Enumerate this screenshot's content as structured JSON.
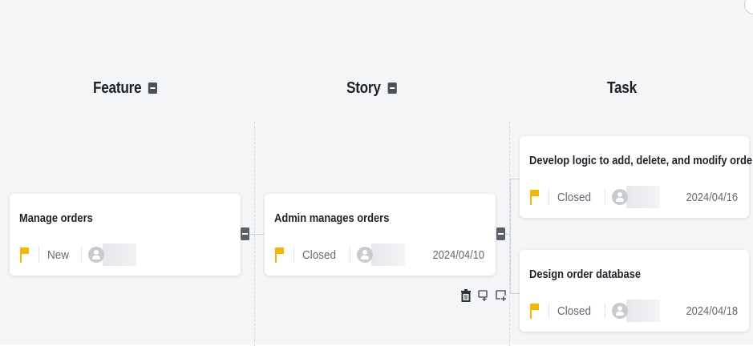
{
  "columns": [
    {
      "title": "Feature"
    },
    {
      "title": "Story"
    },
    {
      "title": "Task"
    }
  ],
  "cards": {
    "feature": {
      "title": "Manage orders",
      "status": "New",
      "date": ""
    },
    "story": {
      "title": "Admin manages orders",
      "status": "Closed",
      "date": "2024/04/10"
    },
    "task1": {
      "title": "Develop logic to add, delete, and modify orders",
      "status": "Closed",
      "date": "2024/04/16"
    },
    "task2": {
      "title": "Design order database",
      "status": "Closed",
      "date": "2024/04/18"
    }
  },
  "icons": {
    "delete": "trash-icon",
    "add_sibling": "add-sibling-node-icon",
    "add_child": "add-child-node-icon"
  },
  "colors": {
    "flag": "#f5b800",
    "background": "#f4f5f7",
    "toggle": "#5b5f67"
  }
}
